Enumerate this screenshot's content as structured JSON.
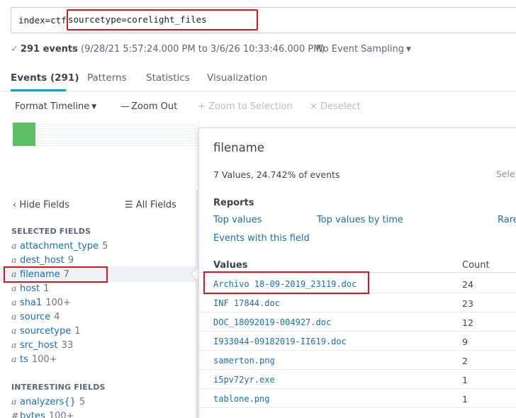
{
  "search": {
    "prefix": "index=ctf ",
    "highlighted": "sourcetype=corelight_files"
  },
  "status": {
    "check_icon": "check-icon",
    "count": "291 events",
    "range": "(9/28/21 5:57:24.000 PM to 3/6/26 10:33:46.000 PM)",
    "sampling": "No Event Sampling"
  },
  "tabs": [
    {
      "label": "Events (291)",
      "active": true
    },
    {
      "label": "Patterns",
      "active": false
    },
    {
      "label": "Statistics",
      "active": false
    },
    {
      "label": "Visualization",
      "active": false
    }
  ],
  "toolbar": {
    "format_timeline": "Format Timeline",
    "zoom_out": "Zoom Out",
    "zoom_to_selection": "Zoom to Selection",
    "deselect": "Deselect"
  },
  "sidebar": {
    "hide_fields": "Hide Fields",
    "all_fields": "All Fields",
    "selected_title": "SELECTED FIELDS",
    "interesting_title": "INTERESTING FIELDS",
    "selected_fields": [
      {
        "type": "a",
        "name": "attachment_type",
        "count": "5"
      },
      {
        "type": "a",
        "name": "dest_host",
        "count": "9"
      },
      {
        "type": "a",
        "name": "filename",
        "count": "7"
      },
      {
        "type": "a",
        "name": "host",
        "count": "1"
      },
      {
        "type": "a",
        "name": "sha1",
        "count": "100+"
      },
      {
        "type": "a",
        "name": "source",
        "count": "4"
      },
      {
        "type": "a",
        "name": "sourcetype",
        "count": "1"
      },
      {
        "type": "a",
        "name": "src_host",
        "count": "33"
      },
      {
        "type": "a",
        "name": "ts",
        "count": "100+"
      }
    ],
    "interesting_fields": [
      {
        "type": "a",
        "name": "analyzers{}",
        "count": "5"
      },
      {
        "type": "#",
        "name": "bytes",
        "count": "100+"
      }
    ]
  },
  "popup": {
    "title": "filename",
    "subtitle": "7 Values, 24.742% of events",
    "sele": "Sele",
    "reports_title": "Reports",
    "reports": {
      "top_values": "Top values",
      "top_values_by_time": "Top values by time",
      "rare": "Rare",
      "events_with_field": "Events with this field"
    },
    "values_header": "Values",
    "count_header": "Count",
    "values": [
      {
        "name": "Archivo 18-09-2019_23119.doc",
        "count": "24"
      },
      {
        "name": "INF 17844.doc",
        "count": "23"
      },
      {
        "name": "DOC_18092019-004927.doc",
        "count": "12"
      },
      {
        "name": "I933044-09182019-II619.doc",
        "count": "9"
      },
      {
        "name": "samerton.png",
        "count": "2"
      },
      {
        "name": "i5pv72yr.exe",
        "count": "1"
      },
      {
        "name": "tablone.png",
        "count": "1"
      }
    ]
  },
  "colors": {
    "accent": "#1a9bcb",
    "link": "#1a6fb0",
    "highlight": "#e0141e",
    "timeline": "#5cc064"
  }
}
